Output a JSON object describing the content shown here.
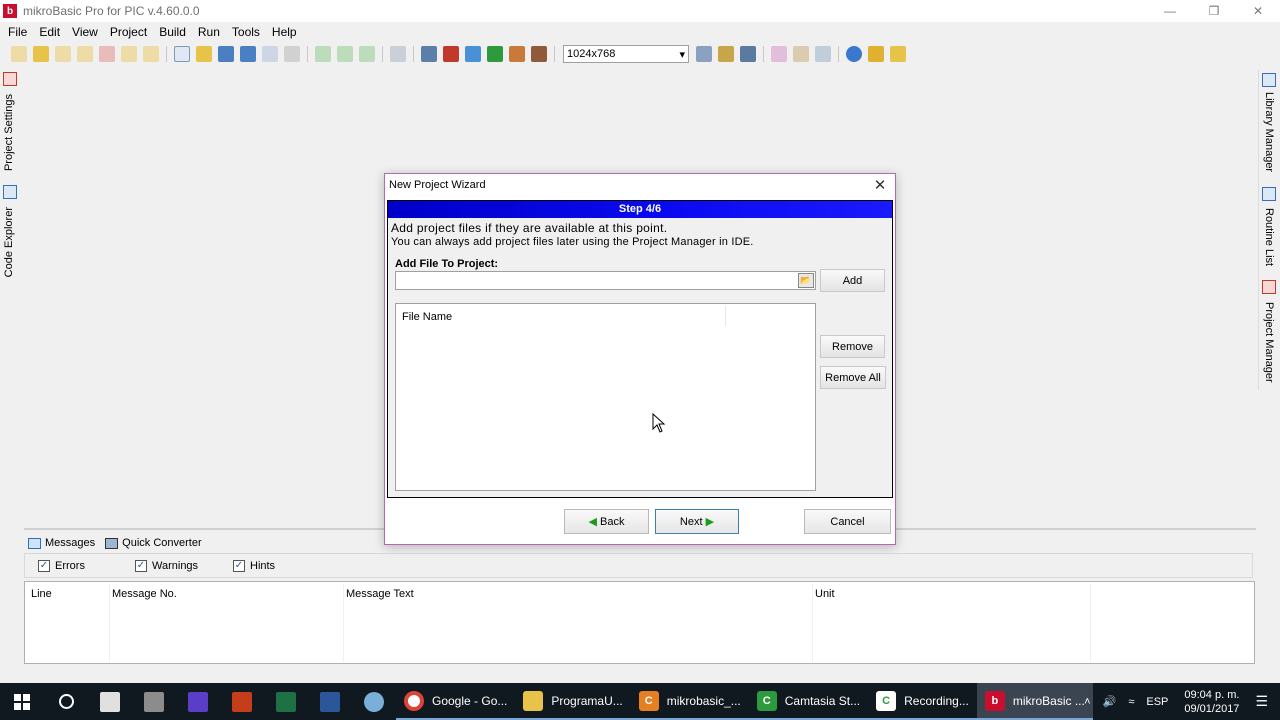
{
  "window": {
    "title": "mikroBasic Pro for PIC v.4.60.0.0",
    "logo_letter": "b"
  },
  "menu": [
    "File",
    "Edit",
    "View",
    "Project",
    "Build",
    "Run",
    "Tools",
    "Help"
  ],
  "toolbar": {
    "resolution": "1024x768"
  },
  "left_panels": {
    "project_settings": "Project Settings",
    "code_explorer": "Code Explorer"
  },
  "right_panels": {
    "library_manager": "Library Manager",
    "routine_list": "Routine List",
    "project_manager": "Project Manager"
  },
  "bottom": {
    "tabs": {
      "messages": "Messages",
      "quick_converter": "Quick Converter"
    },
    "filters": {
      "errors": "Errors",
      "warnings": "Warnings",
      "hints": "Hints"
    },
    "columns": {
      "line": "Line",
      "message_no": "Message No.",
      "message_text": "Message Text",
      "unit": "Unit"
    }
  },
  "dialog": {
    "title": "New Project Wizard",
    "step": "Step 4/6",
    "info_main": "Add project files if they are available at this point.",
    "info_sub": "You can always add project files later using the Project Manager in IDE.",
    "add_file_label": "Add File To Project:",
    "add_file_value": "",
    "add_button": "Add",
    "file_list_header": "File Name",
    "remove_button": "Remove",
    "remove_all_button": "Remove All",
    "back_button": "Back",
    "next_button": "Next",
    "cancel_button": "Cancel"
  },
  "taskbar": {
    "tasks": [
      {
        "label": "Google - Go...",
        "color": "#ffffff"
      },
      {
        "label": "ProgramaU...",
        "color": "#e8c34a"
      },
      {
        "label": "mikrobasic_...",
        "color": "#e67e22"
      },
      {
        "label": "Camtasia St...",
        "color": "#2e9a3e"
      },
      {
        "label": "Recording...",
        "color": "#2e9a3e"
      },
      {
        "label": "mikroBasic ...",
        "color": "#c8102e"
      }
    ],
    "language": "ESP",
    "time": "09:04 p. m.",
    "date": "09/01/2017"
  }
}
